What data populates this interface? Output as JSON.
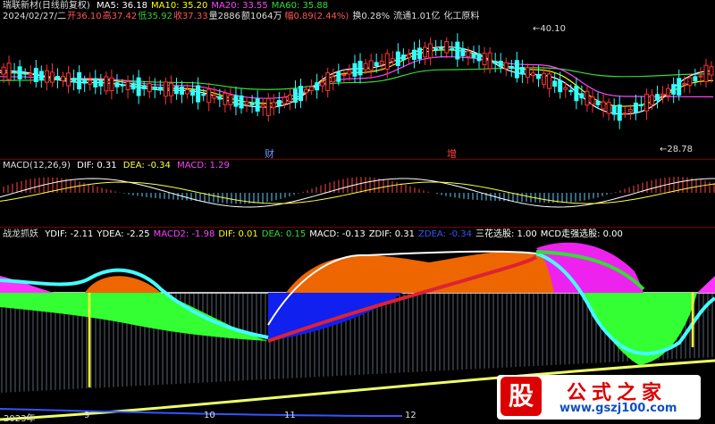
{
  "header": {
    "title": "瑞联新材(日线前复权)",
    "ma": [
      {
        "label": "MA5: 36.18",
        "color": "#ffffff"
      },
      {
        "label": "MA10: 35.20",
        "color": "#ffff00"
      },
      {
        "label": "MA20: 33.55",
        "color": "#ff44ff"
      },
      {
        "label": "MA60: 35.88",
        "color": "#33dd33"
      }
    ]
  },
  "quote": {
    "date": "2024/02/27/二",
    "open": "开36.10",
    "high": "高37.42",
    "low": "低35.92",
    "close": "收37.33",
    "volume": "量2886",
    "amount": "额1064万",
    "change": "幅0.89(2.44%)",
    "turnover": "换0.28%",
    "float": "流通1.01亿",
    "industry": "化工原料"
  },
  "price_pane": {
    "high_label": "40.10",
    "low_label": "28.78",
    "markers": [
      {
        "text": "财",
        "color": "#6699ff"
      },
      {
        "text": "增",
        "color": "#ff4444"
      }
    ]
  },
  "macd_pane": {
    "title": "MACD(12,26,9)",
    "dif": "DIF: 0.31",
    "dea": "DEA: -0.34",
    "macd": "MACD: 1.29"
  },
  "zl_pane": {
    "title": "战龙抓妖",
    "items": [
      {
        "label": "YDIF: -2.11",
        "color": "#ffffff"
      },
      {
        "label": "YDEA: -2.25",
        "color": "#ffffff"
      },
      {
        "label": "MACD2: -1.98",
        "color": "#ff44ff"
      },
      {
        "label": "DIF: 0.01",
        "color": "#ffff00"
      },
      {
        "label": "DEA: 0.15",
        "color": "#33dd33"
      },
      {
        "label": "MACD: -0.13",
        "color": "#ffffff"
      },
      {
        "label": "ZDIF: 0.31",
        "color": "#ffffff"
      },
      {
        "label": "ZDEA: -0.34",
        "color": "#3355ff"
      },
      {
        "label": "三花选股: 1.00",
        "color": "#ffffff"
      },
      {
        "label": "MCD走强选股: 0.00",
        "color": "#ffffff"
      }
    ]
  },
  "time_axis": [
    "2023年",
    "9",
    "10",
    "11",
    "12"
  ],
  "watermark": {
    "logo": "股",
    "name": "公式之家",
    "url": "www.gszj100.com"
  },
  "chart_data": {
    "type": "line",
    "categories": [
      "2023年",
      "9",
      "10",
      "11",
      "12"
    ],
    "series": [
      {
        "name": "MA5",
        "values": [
          36.2,
          35.0,
          34.2,
          32.5,
          36.4,
          38.6,
          35.8,
          31.8,
          36.18
        ]
      },
      {
        "name": "MA10",
        "values": [
          36.0,
          35.3,
          34.4,
          32.9,
          36.0,
          38.3,
          36.3,
          32.6,
          35.2
        ]
      },
      {
        "name": "MA20",
        "values": [
          35.6,
          35.4,
          34.7,
          33.4,
          35.4,
          37.6,
          36.8,
          33.6,
          33.55
        ]
      },
      {
        "name": "MA60",
        "values": [
          35.2,
          35.3,
          35.0,
          34.3,
          35.0,
          36.3,
          36.5,
          35.6,
          35.88
        ]
      }
    ],
    "ylim": [
      28.0,
      41.0
    ],
    "annotations": [
      "40.10",
      "28.78"
    ]
  }
}
